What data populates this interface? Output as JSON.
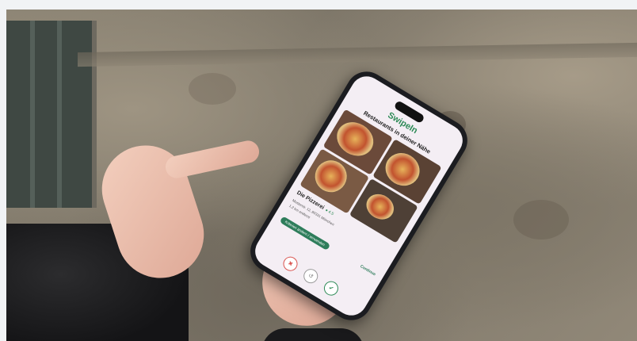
{
  "app": {
    "logo_text": "SwipeIn",
    "heading": "Restaurants in deiner Nähe",
    "restaurant_name": "Die Pizzerei",
    "restaurant_tag": "● 4.5",
    "address_line1": "Musterstr. 12, 80331 München",
    "address_line2": "1,2 km entfernt",
    "filter_label": "Kriterien ändern / verwenden",
    "continue_label": "Continue",
    "actions": {
      "dislike_icon": "thumbs-down-icon",
      "undo_icon": "undo-icon",
      "like_icon": "thumbs-up-icon"
    }
  },
  "colors": {
    "accent": "#2e8b57",
    "screen_bg": "#f4eef4",
    "dislike": "#d9534f",
    "like": "#2e8b57"
  }
}
